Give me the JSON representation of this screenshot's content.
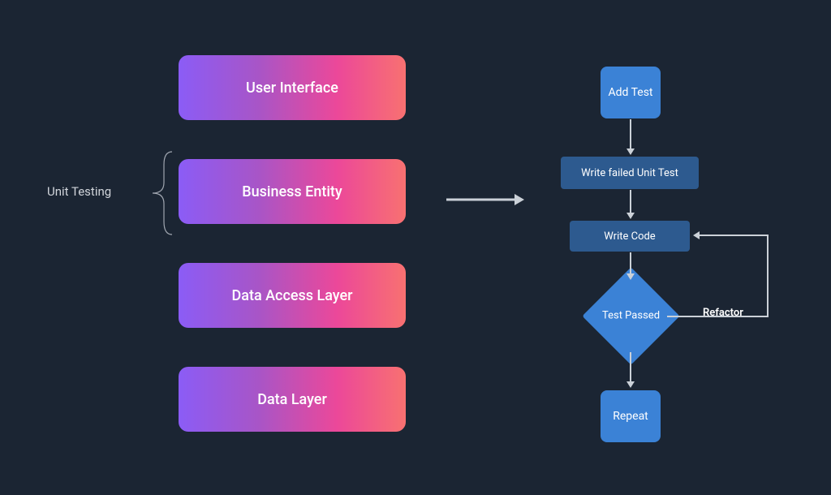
{
  "layers": {
    "items": [
      {
        "label": "User Interface"
      },
      {
        "label": "Business Entity"
      },
      {
        "label": "Data Access Layer"
      },
      {
        "label": "Data Layer"
      }
    ],
    "brace_label": "Unit Testing"
  },
  "flow": {
    "add_test": "Add Test",
    "write_failed": "Write failed Unit Test",
    "write_code": "Write Code",
    "test_passed": "Test Passed",
    "repeat": "Repeat",
    "refactor": "Refactor"
  }
}
